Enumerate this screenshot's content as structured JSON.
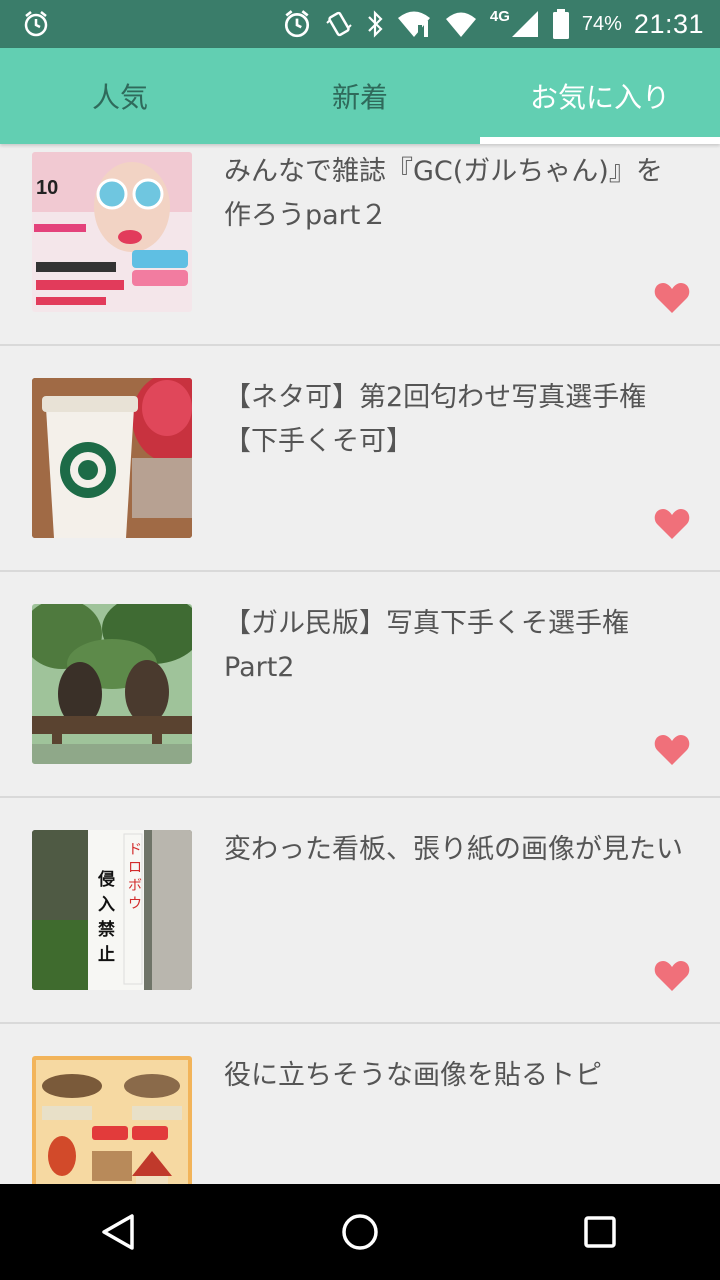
{
  "status_bar": {
    "network_type": "4G",
    "battery_percent": "74%",
    "time": "21:31",
    "icons": [
      "alarm-icon",
      "alarm-clock-icon",
      "vibrate-icon",
      "bluetooth-icon",
      "wifi-icon",
      "wifi-icon",
      "cell-signal-icon",
      "battery-icon"
    ]
  },
  "tabs": [
    {
      "label": "人気",
      "active": false
    },
    {
      "label": "新着",
      "active": false
    },
    {
      "label": "お気に入り",
      "active": true
    }
  ],
  "colors": {
    "accent": "#62cfb2",
    "status_bar": "#3a7d6a",
    "heart": "#f0707a",
    "background": "#efefef"
  },
  "favorites": [
    {
      "title": "みんなで雑誌『GC(ガルちゃん)』を作ろうpart２",
      "thumbnail": "magazine-cover-image",
      "favorited": true
    },
    {
      "title": "【ネタ可】第2回匂わせ写真選手権【下手くそ可】",
      "thumbnail": "coffee-cup-photo",
      "favorited": true
    },
    {
      "title": "【ガル民版】写真下手くそ選手権Part2",
      "thumbnail": "owl-statues-photo",
      "favorited": true
    },
    {
      "title": "変わった看板、張り紙の画像が見たい",
      "thumbnail": "sign-photo",
      "favorited": true
    },
    {
      "title": "役に立ちそうな画像を貼るトピ",
      "thumbnail": "illustrated-chart-image",
      "favorited": false
    }
  ],
  "nav_bar": {
    "back": "back-icon",
    "home": "home-icon",
    "recents": "recents-icon"
  }
}
